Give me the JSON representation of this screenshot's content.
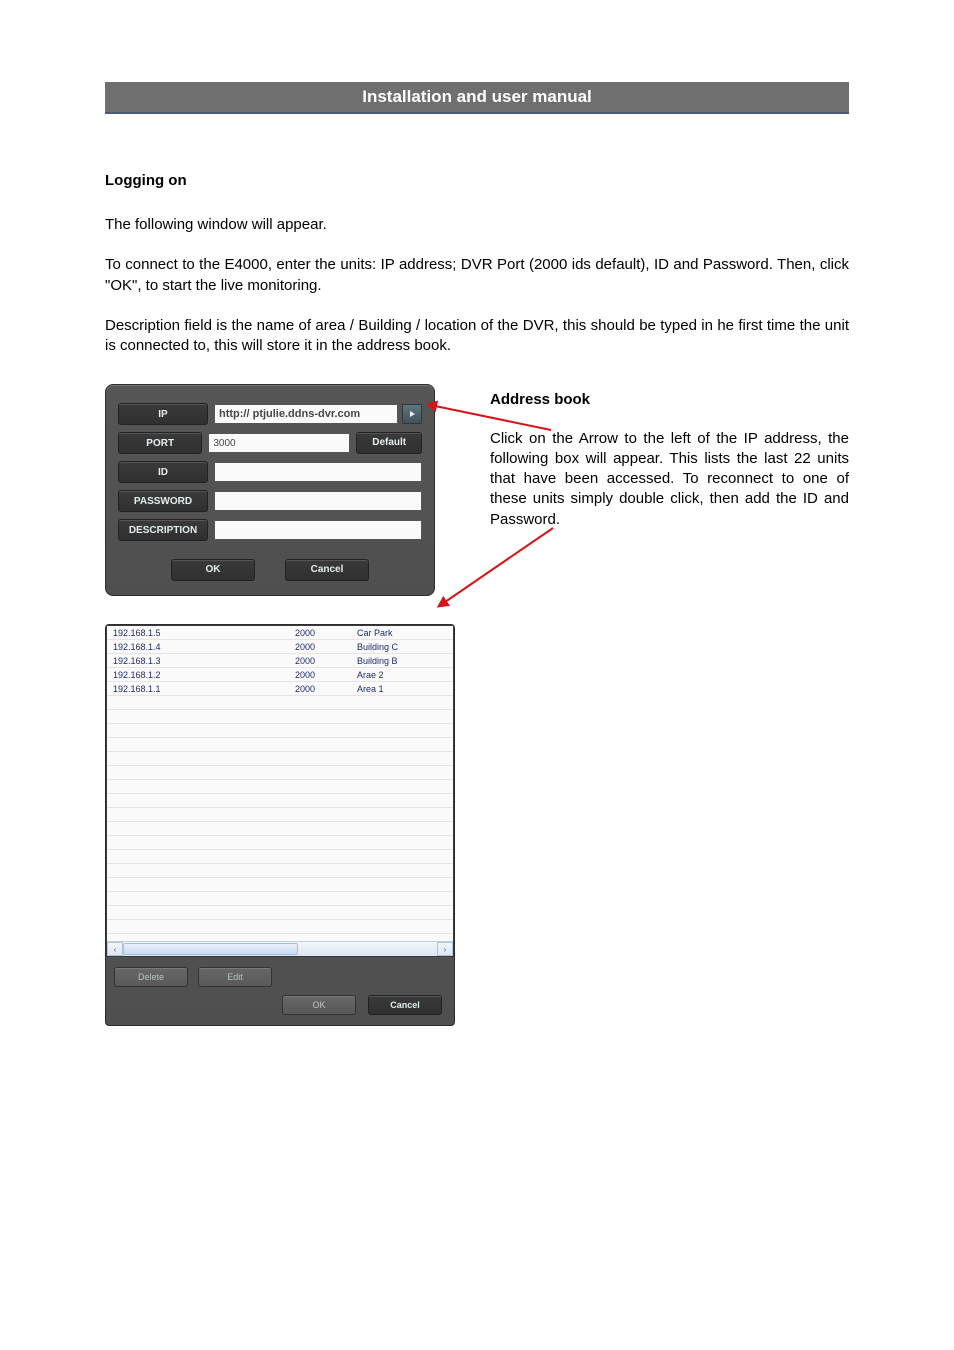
{
  "doc_title": "Installation and user manual",
  "section_heading": "Logging on",
  "paragraphs": {
    "p1": "The following window will appear.",
    "p2": "To connect to the E4000, enter the units: IP address; DVR Port (2000 ids default), ID and Password. Then, click \"OK\", to start the live monitoring.",
    "p3": "Description field is the name of area / Building / location of the DVR, this should be typed in he first time the unit is connected to, this will store it in the address book."
  },
  "login_dialog": {
    "labels": {
      "ip": "IP",
      "port": "PORT",
      "id": "ID",
      "password": "PASSWORD",
      "description": "DESCRIPTION"
    },
    "values": {
      "ip": "http:// ptjulie.ddns-dvr.com",
      "port": "3000",
      "id": "",
      "password": "",
      "description": ""
    },
    "buttons": {
      "default": "Default",
      "ok": "OK",
      "cancel": "Cancel"
    }
  },
  "address_book_callout": {
    "heading": "Address book",
    "body": "Click on the Arrow to the left of the IP address, the following box will appear. This lists the last 22 units that have been accessed. To reconnect to one of these units simply double click, then add the ID and Password."
  },
  "address_dialog": {
    "rows": [
      {
        "ip": "192.168.1.5",
        "port": "2000",
        "desc": "Car Park"
      },
      {
        "ip": "192.168.1.4",
        "port": "2000",
        "desc": "Building C"
      },
      {
        "ip": "192.168.1.3",
        "port": "2000",
        "desc": "Building B"
      },
      {
        "ip": "192.168.1.2",
        "port": "2000",
        "desc": "Arae 2"
      },
      {
        "ip": "192.168.1.1",
        "port": "2000",
        "desc": "Area 1"
      }
    ],
    "buttons": {
      "delete": "Delete",
      "edit": "Edit",
      "ok": "OK",
      "cancel": "Cancel"
    }
  }
}
